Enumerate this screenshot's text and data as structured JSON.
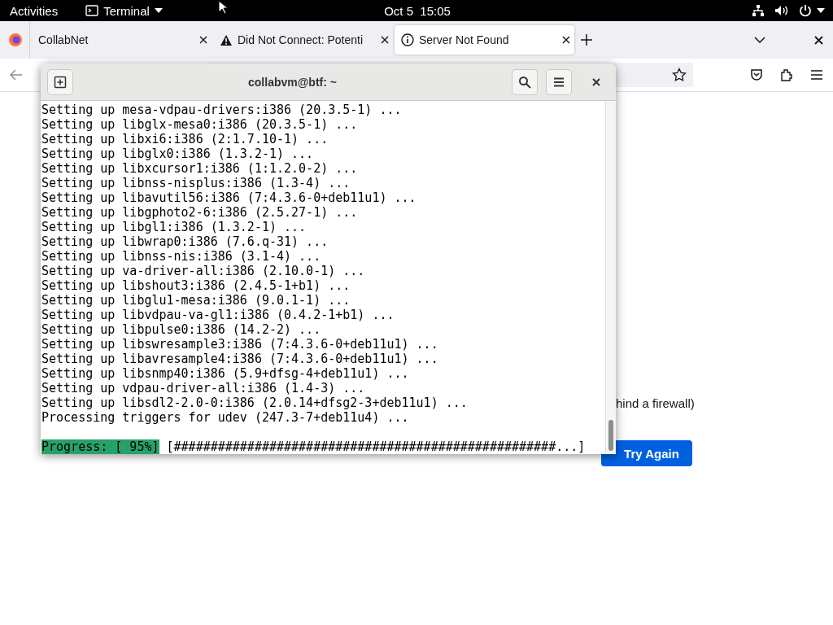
{
  "top_bar": {
    "activities": "Activities",
    "app_menu": "Terminal",
    "clock": "Oct 5  15:05"
  },
  "browser": {
    "tabs": [
      {
        "label": "CollabNet",
        "kind": "plain",
        "selected": false
      },
      {
        "label": "Did Not Connect: Potenti",
        "kind": "warning",
        "selected": false
      },
      {
        "label": "Server Not Found",
        "kind": "info",
        "selected": true
      }
    ],
    "page": {
      "text": "hind a firewall)",
      "button": "Try Again"
    }
  },
  "terminal": {
    "title": "collabvm@btf: ~",
    "lines": [
      "Setting up mesa-vdpau-drivers:i386 (20.3.5-1) ...",
      "Setting up libglx-mesa0:i386 (20.3.5-1) ...",
      "Setting up libxi6:i386 (2:1.7.10-1) ...",
      "Setting up libglx0:i386 (1.3.2-1) ...",
      "Setting up libxcursor1:i386 (1:1.2.0-2) ...",
      "Setting up libnss-nisplus:i386 (1.3-4) ...",
      "Setting up libavutil56:i386 (7:4.3.6-0+deb11u1) ...",
      "Setting up libgphoto2-6:i386 (2.5.27-1) ...",
      "Setting up libgl1:i386 (1.3.2-1) ...",
      "Setting up libwrap0:i386 (7.6.q-31) ...",
      "Setting up libnss-nis:i386 (3.1-4) ...",
      "Setting up va-driver-all:i386 (2.10.0-1) ...",
      "Setting up libshout3:i386 (2.4.5-1+b1) ...",
      "Setting up libglu1-mesa:i386 (9.0.1-1) ...",
      "Setting up libvdpau-va-gl1:i386 (0.4.2-1+b1) ...",
      "Setting up libpulse0:i386 (14.2-2) ...",
      "Setting up libswresample3:i386 (7:4.3.6-0+deb11u1) ...",
      "Setting up libavresample4:i386 (7:4.3.6-0+deb11u1) ...",
      "Setting up libsnmp40:i386 (5.9+dfsg-4+deb11u1) ...",
      "Setting up vdpau-driver-all:i386 (1.4-3) ...",
      "Setting up libsdl2-2.0-0:i386 (2.0.14+dfsg2-3+deb11u1) ...",
      "Processing triggers for udev (247.3-7+deb11u4) ..."
    ],
    "progress_label": "Progress: [ 95%]",
    "progress_bar": "[####################################################...]"
  }
}
